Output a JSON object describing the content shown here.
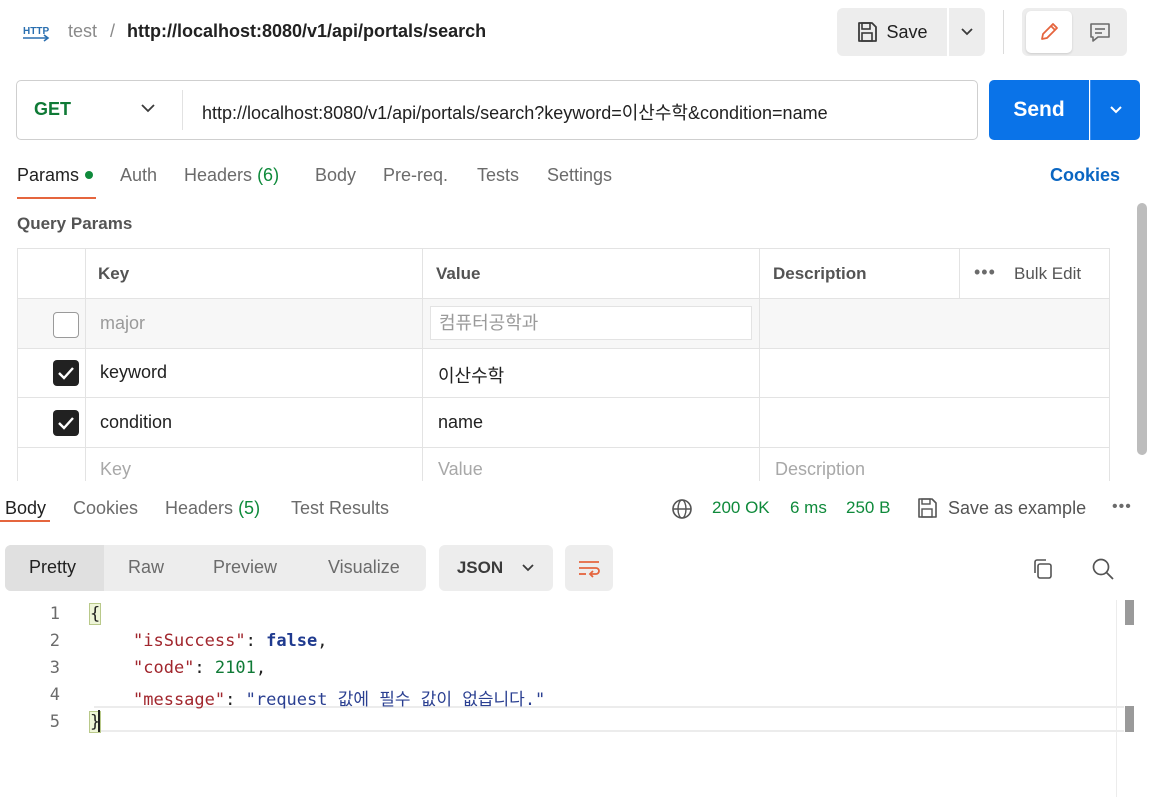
{
  "top": {
    "workspace": "test",
    "separator": "/",
    "title": "http://localhost:8080/v1/api/portals/search",
    "save_label": "Save",
    "http_badge": "HTTP"
  },
  "request": {
    "method": "GET",
    "url": "http://localhost:8080/v1/api/portals/search?keyword=이산수학&condition=name",
    "send_label": "Send"
  },
  "request_tabs": [
    {
      "label": "Params",
      "active": true
    },
    {
      "label": "Auth"
    },
    {
      "label": "Headers",
      "count": "(6)"
    },
    {
      "label": "Body"
    },
    {
      "label": "Pre-req."
    },
    {
      "label": "Tests"
    },
    {
      "label": "Settings"
    }
  ],
  "cookies_link": "Cookies",
  "query_params": {
    "title": "Query Params",
    "headers": {
      "key": "Key",
      "value": "Value",
      "description": "Description",
      "bulk_edit": "Bulk Edit"
    },
    "rows": [
      {
        "enabled": false,
        "key": "major",
        "value": "컴퓨터공학과",
        "description": ""
      },
      {
        "enabled": true,
        "key": "keyword",
        "value": "이산수학",
        "description": ""
      },
      {
        "enabled": true,
        "key": "condition",
        "value": "name",
        "description": ""
      }
    ],
    "placeholders": {
      "key": "Key",
      "value": "Value",
      "description": "Description"
    }
  },
  "response_tabs": [
    {
      "label": "Body",
      "active": true
    },
    {
      "label": "Cookies"
    },
    {
      "label": "Headers",
      "count": "(5)"
    },
    {
      "label": "Test Results"
    }
  ],
  "response_status": {
    "status": "200 OK",
    "time": "6 ms",
    "size": "250 B",
    "save_example": "Save as example"
  },
  "format_tabs": [
    {
      "label": "Pretty",
      "active": true
    },
    {
      "label": "Raw"
    },
    {
      "label": "Preview"
    },
    {
      "label": "Visualize"
    }
  ],
  "format_type": "JSON",
  "body_lines": {
    "n1": "1",
    "n2": "2",
    "n3": "3",
    "n4": "4",
    "n5": "5",
    "open": "{",
    "k1": "\"isSuccess\"",
    "v1": "false",
    "k2": "\"code\"",
    "v2": "2101",
    "k3": "\"message\"",
    "v3": "\"request 값에 필수 값이 없습니다.\"",
    "colon": ": ",
    "comma": ",",
    "close": "}"
  },
  "colors": {
    "accent": "#e5653e",
    "send": "#0a73e8",
    "success": "#0f8a3b",
    "link": "#0a66c2"
  }
}
